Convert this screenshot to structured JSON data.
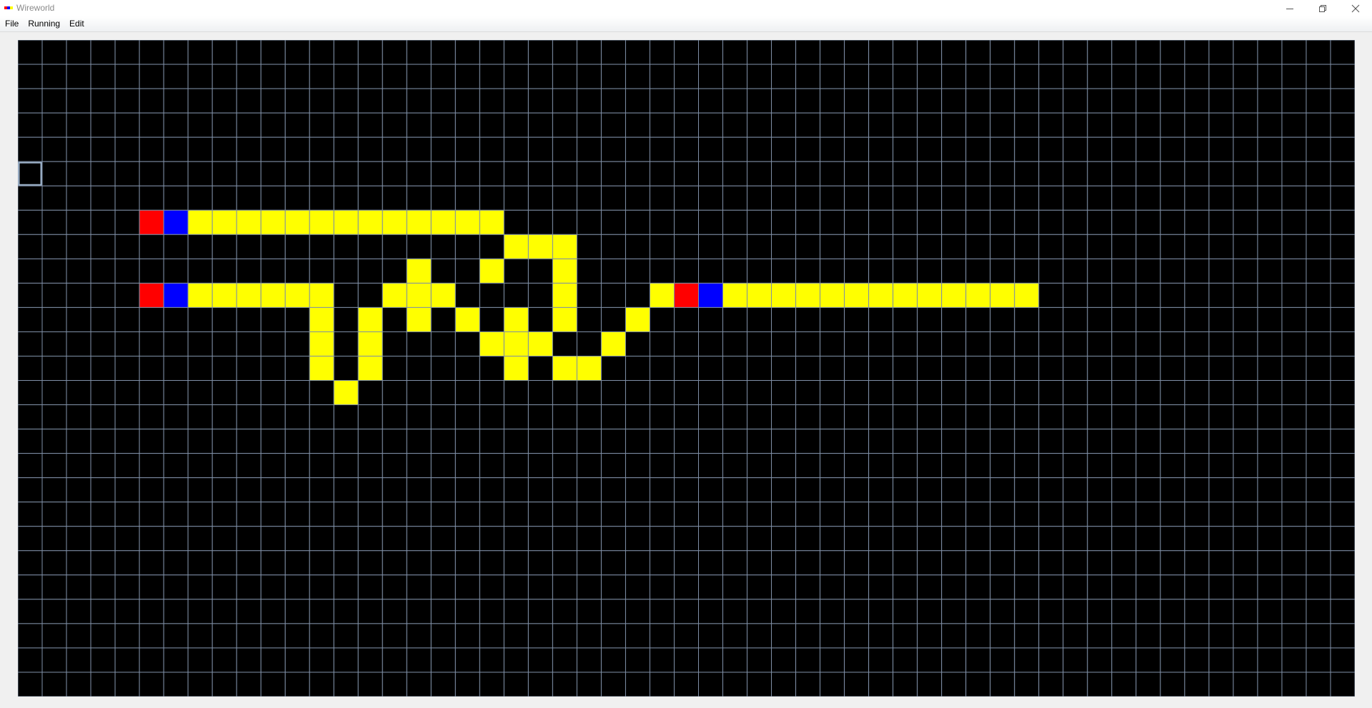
{
  "window": {
    "title": "Wireworld",
    "controls": [
      "minimize-icon",
      "restore-icon",
      "close-icon"
    ]
  },
  "menu": {
    "items": [
      "File",
      "Running",
      "Edit"
    ]
  },
  "grid": {
    "columns": 55,
    "rows": 27,
    "selected_cell": [
      0,
      5
    ],
    "colors": {
      "empty": "#000000",
      "grid_line": "#7f8fa6",
      "conductor": "#ffff00",
      "electron_head": "#0000ff",
      "electron_tail": "#ff0000",
      "selection": "#9fb4cc"
    },
    "cells": {
      "electron_tail": [
        [
          5,
          7
        ],
        [
          5,
          10
        ],
        [
          27,
          10
        ]
      ],
      "electron_head": [
        [
          6,
          7
        ],
        [
          6,
          10
        ],
        [
          28,
          10
        ]
      ],
      "conductor": [
        [
          7,
          7
        ],
        [
          8,
          7
        ],
        [
          9,
          7
        ],
        [
          10,
          7
        ],
        [
          11,
          7
        ],
        [
          12,
          7
        ],
        [
          13,
          7
        ],
        [
          14,
          7
        ],
        [
          15,
          7
        ],
        [
          16,
          7
        ],
        [
          17,
          7
        ],
        [
          18,
          7
        ],
        [
          19,
          7
        ],
        [
          20,
          8
        ],
        [
          21,
          8
        ],
        [
          22,
          8
        ],
        [
          16,
          9
        ],
        [
          19,
          9
        ],
        [
          22,
          9
        ],
        [
          7,
          10
        ],
        [
          8,
          10
        ],
        [
          9,
          10
        ],
        [
          10,
          10
        ],
        [
          11,
          10
        ],
        [
          12,
          10
        ],
        [
          15,
          10
        ],
        [
          16,
          10
        ],
        [
          17,
          10
        ],
        [
          22,
          10
        ],
        [
          26,
          10
        ],
        [
          29,
          10
        ],
        [
          30,
          10
        ],
        [
          31,
          10
        ],
        [
          32,
          10
        ],
        [
          33,
          10
        ],
        [
          34,
          10
        ],
        [
          35,
          10
        ],
        [
          36,
          10
        ],
        [
          37,
          10
        ],
        [
          38,
          10
        ],
        [
          39,
          10
        ],
        [
          40,
          10
        ],
        [
          41,
          10
        ],
        [
          12,
          11
        ],
        [
          14,
          11
        ],
        [
          16,
          11
        ],
        [
          18,
          11
        ],
        [
          20,
          11
        ],
        [
          22,
          11
        ],
        [
          25,
          11
        ],
        [
          12,
          12
        ],
        [
          14,
          12
        ],
        [
          19,
          12
        ],
        [
          20,
          12
        ],
        [
          21,
          12
        ],
        [
          24,
          12
        ],
        [
          12,
          13
        ],
        [
          14,
          13
        ],
        [
          20,
          13
        ],
        [
          22,
          13
        ],
        [
          23,
          13
        ],
        [
          13,
          14
        ]
      ]
    }
  }
}
